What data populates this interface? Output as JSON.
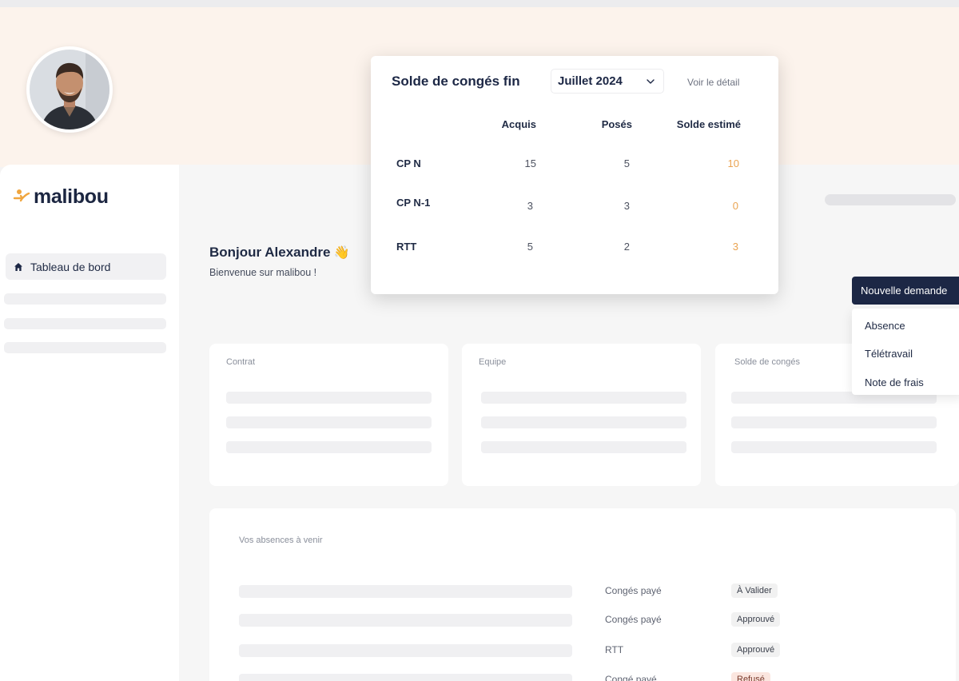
{
  "brand": {
    "name": "malibou",
    "accent": "#f0a63f",
    "navy": "#1c2745"
  },
  "user": {
    "avatar_alt": ""
  },
  "sidebar": {
    "items": [
      {
        "label": "Tableau de bord",
        "icon": "home-icon",
        "active": true
      }
    ]
  },
  "main": {
    "greeting": "Bonjour Alexandre",
    "greeting_emoji": "👋",
    "welcome": "Bienvenue sur malibou !",
    "cards": [
      {
        "title": "Contrat"
      },
      {
        "title": "Equipe"
      },
      {
        "title": "Solde de congés"
      }
    ],
    "absences": {
      "title": "Vos absences à venir",
      "rows": [
        {
          "type": "Congés payé",
          "status": "À Valider"
        },
        {
          "type": "Congés payé",
          "status": "Approuvé"
        },
        {
          "type": "RTT",
          "status": "Approuvé"
        },
        {
          "type": "Congé payé",
          "status": "Refusé"
        }
      ]
    }
  },
  "new_request": {
    "label": "Nouvelle demande",
    "menu": [
      "Absence",
      "Télétravail",
      "Note de frais"
    ]
  },
  "balance_popup": {
    "title": "Solde de congés fin",
    "month": "Juillet 2024",
    "detail_link": "Voir le détail",
    "columns": [
      "Acquis",
      "Posés",
      "Solde estimé"
    ],
    "rows": [
      {
        "label": "CP N",
        "acquired": "15",
        "taken": "5",
        "balance": "10"
      },
      {
        "label": "CP N-1",
        "acquired": "3",
        "taken": "3",
        "balance": "0"
      },
      {
        "label": "RTT",
        "acquired": "5",
        "taken": "2",
        "balance": "3"
      }
    ]
  }
}
